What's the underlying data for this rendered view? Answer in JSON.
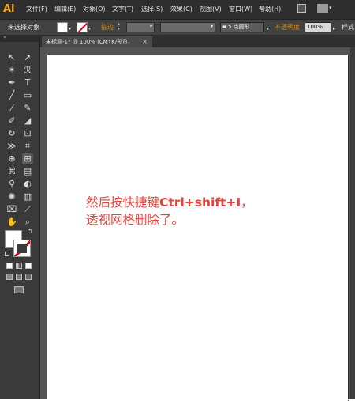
{
  "app": {
    "logo": "Ai"
  },
  "menubar": {
    "items": [
      "文件(F)",
      "编辑(E)",
      "对象(O)",
      "文字(T)",
      "选择(S)",
      "效果(C)",
      "视图(V)",
      "窗口(W)",
      "帮助(H)"
    ]
  },
  "controlbar": {
    "selection_status": "未选择对象",
    "stroke_label": "描边",
    "stroke_style": "5 点圆形",
    "opacity_label": "不透明度",
    "opacity_value": "100%",
    "style_label": "样式"
  },
  "document": {
    "tab_title": "未标题-1* @ 100% (CMYK/预览)",
    "tab_close": "×"
  },
  "artboard_note": {
    "line1_prefix": "然后按快捷键",
    "line1_shortcut": "Ctrl+shift+I",
    "line1_suffix": "，",
    "line2": "透视网格删除了。"
  },
  "colors": {
    "accent": "#f5a623",
    "note_text": "#e8413c",
    "stroke_none": "#d0021b",
    "ui_dark": "#3b3b3b"
  },
  "icons": {
    "tools": [
      "selection-tool-icon",
      "direct-selection-tool-icon",
      "magic-wand-tool-icon",
      "lasso-tool-icon",
      "pen-tool-icon",
      "type-tool-icon",
      "line-tool-icon",
      "rectangle-tool-icon",
      "paintbrush-tool-icon",
      "pencil-tool-icon",
      "blob-brush-tool-icon",
      "eraser-tool-icon",
      "rotate-tool-icon",
      "scale-tool-icon",
      "width-tool-icon",
      "free-transform-tool-icon",
      "shape-builder-tool-icon",
      "perspective-grid-tool-icon",
      "mesh-tool-icon",
      "gradient-tool-icon",
      "eyedropper-tool-icon",
      "blend-tool-icon",
      "symbol-sprayer-tool-icon",
      "column-graph-tool-icon",
      "artboard-tool-icon",
      "slice-tool-icon",
      "hand-tool-icon",
      "zoom-tool-icon"
    ]
  }
}
